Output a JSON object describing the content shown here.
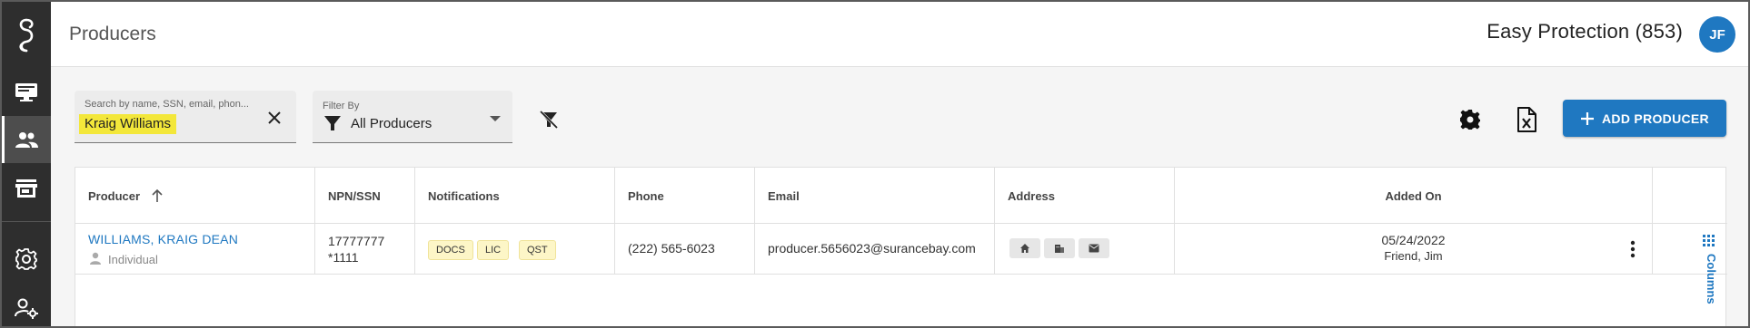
{
  "header": {
    "title": "Producers",
    "agency": "Easy Protection (853)",
    "avatar_initials": "JF"
  },
  "sidebar": {
    "items": [
      {
        "icon": "monitor-icon",
        "active": false
      },
      {
        "icon": "people-icon",
        "active": true
      },
      {
        "icon": "store-icon",
        "active": false
      },
      {
        "icon": "gear-icon",
        "active": false
      },
      {
        "icon": "user-settings-icon",
        "active": false
      }
    ]
  },
  "toolbar": {
    "search": {
      "label": "Search by name, SSN, email, phon...",
      "value": "Kraig Williams"
    },
    "filter": {
      "label": "Filter By",
      "value": "All Producers"
    },
    "add_label": "ADD PRODUCER"
  },
  "table": {
    "columns": [
      "Producer",
      "NPN/SSN",
      "Notifications",
      "Phone",
      "Email",
      "Address",
      "Added On"
    ],
    "rows": [
      {
        "producer_name": "WILLIAMS, KRAIG DEAN",
        "producer_type": "Individual",
        "npn": "17777777",
        "ssn": "*1111",
        "notifications": [
          "DOCS",
          "LIC",
          "QST"
        ],
        "phone": "(222) 565-6023",
        "email": "producer.5656023@surancebay.com",
        "address_icons": [
          "home-icon",
          "business-icon",
          "mail-icon"
        ],
        "added_on_date": "05/24/2022",
        "added_on_by": "Friend, Jim"
      }
    ]
  },
  "columns_panel_label": "Columns",
  "colors": {
    "accent": "#1f78c1",
    "sidebar": "#2e2e2e",
    "highlight": "#f3e73a",
    "badge": "#fdf6c7"
  }
}
